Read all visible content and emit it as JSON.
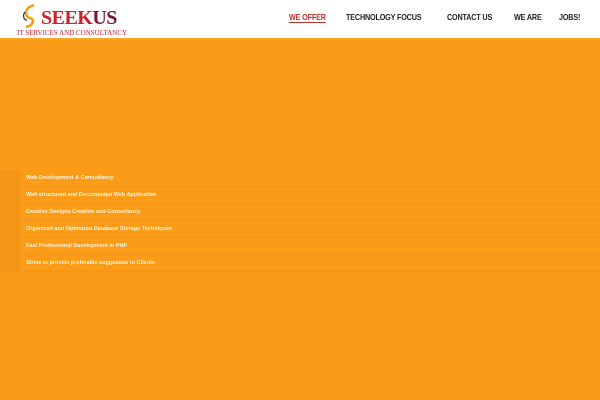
{
  "logo": {
    "brand_a": "SEEK",
    "brand_b": "US",
    "tagline": "IT SERVICES AND CONSULTANCY"
  },
  "nav": [
    {
      "label": "WE OFFER",
      "active": true
    },
    {
      "label": "TECHNOLOGY FOCUS"
    },
    {
      "label": "CONTACT US"
    },
    {
      "label": "WE ARE"
    },
    {
      "label": "JOBS!"
    }
  ],
  "services": [
    "Web Development & Consultancy",
    "Well structured and Documented Web Application",
    "Creative Designs Creation and Consultancy",
    "Organized and Optimized Database Storage Techniques",
    "Fast Professional Development in PHP",
    "Strive to provide preferable suggestion to Clients"
  ]
}
